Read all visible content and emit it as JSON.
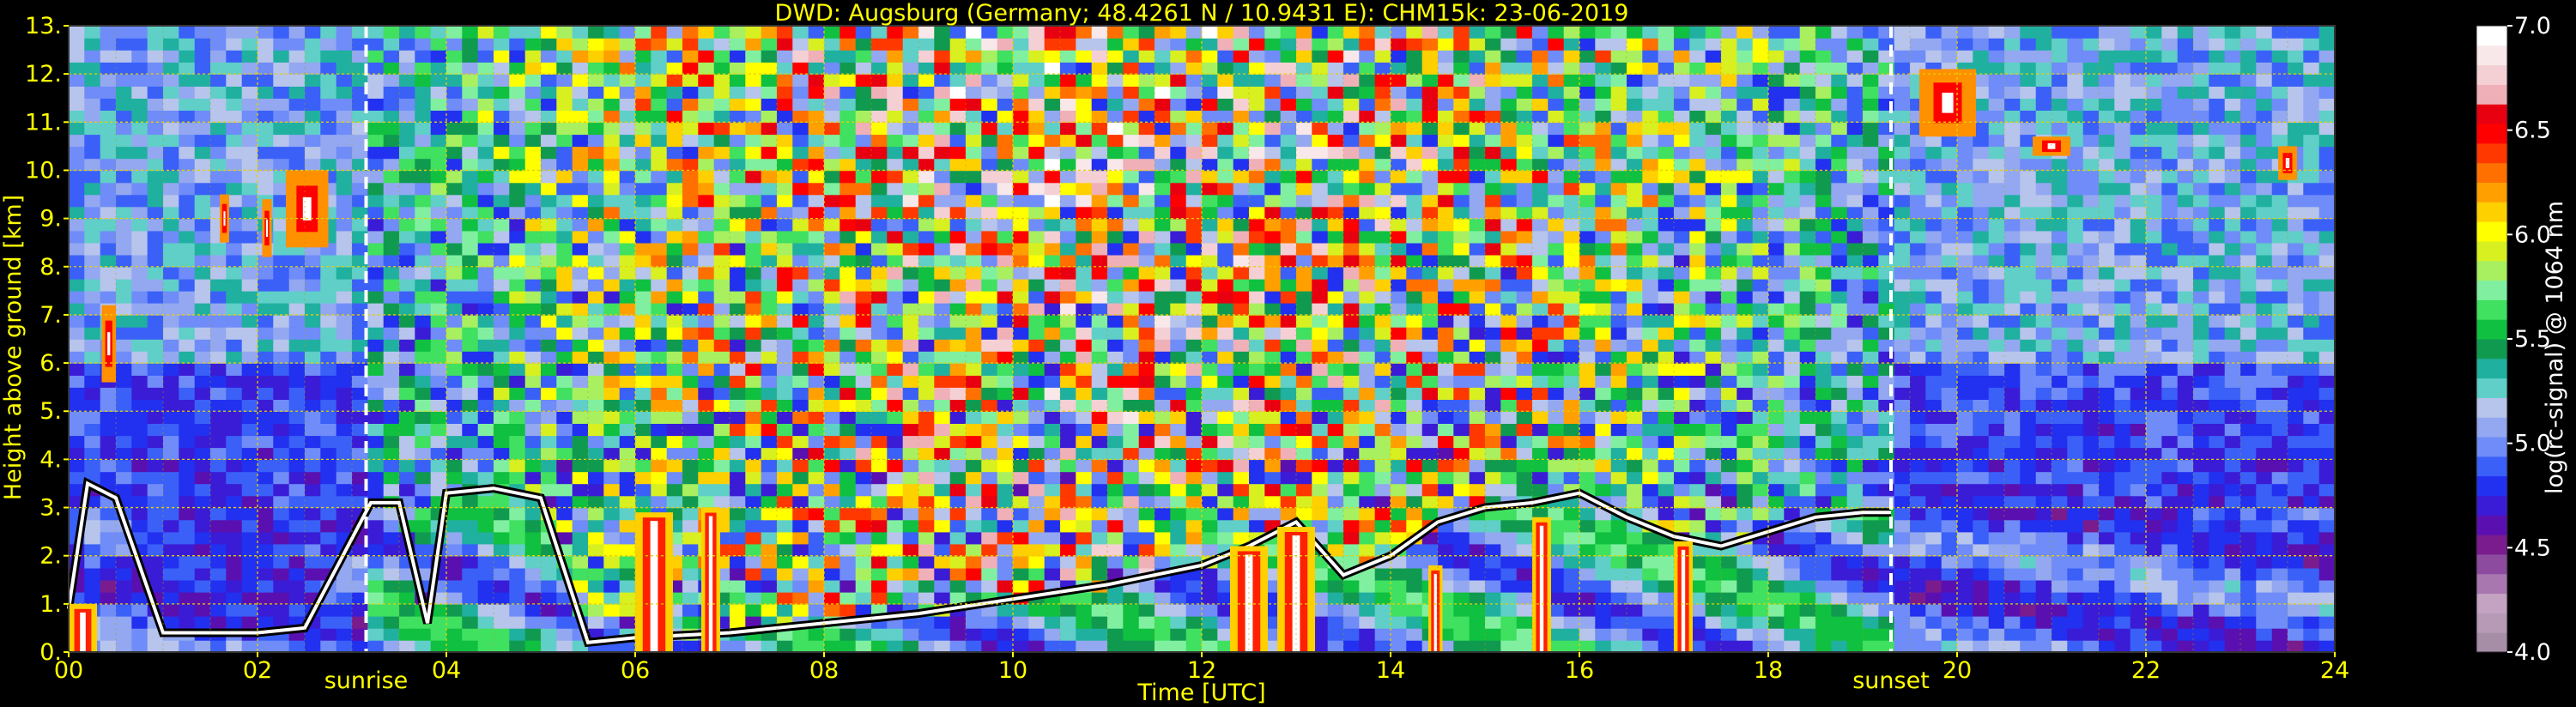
{
  "chart_data": {
    "type": "heatmap",
    "title": "DWD: Augsburg (Germany; 48.4261 N / 10.9431 E):    CHM15k: 23-06-2019",
    "xlabel": "Time [UTC]",
    "ylabel": "Height above ground [km]",
    "x_ticks": [
      "00",
      "02",
      "04",
      "06",
      "08",
      "10",
      "12",
      "14",
      "16",
      "18",
      "20",
      "22",
      "24"
    ],
    "xlim": [
      0,
      24
    ],
    "y_ticks": [
      "0.",
      "1.",
      "2.",
      "3.",
      "4.",
      "5.",
      "6.",
      "7.",
      "8.",
      "9.",
      "10.",
      "11.",
      "12.",
      "13."
    ],
    "ylim": [
      0,
      13
    ],
    "grid": true,
    "colorbar": {
      "label": "log(rc-signal) @ 1064 nm",
      "range": [
        4.0,
        7.0
      ],
      "ticks": [
        "4.0",
        "4.5",
        "5.0",
        "5.5",
        "6.0",
        "6.5",
        "7.0"
      ],
      "colors": [
        "#a58ea6",
        "#b79bb6",
        "#c4a3c2",
        "#a877b0",
        "#8d4ba0",
        "#7a1c8e",
        "#5a10b0",
        "#3a1cd6",
        "#2230f0",
        "#3a60f8",
        "#6f8cf8",
        "#93a8f0",
        "#b7c4ec",
        "#5fcfc8",
        "#20b0a0",
        "#109a50",
        "#10c040",
        "#40e060",
        "#80f0a0",
        "#a8f060",
        "#d8f020",
        "#ffff00",
        "#ffd000",
        "#ffa000",
        "#ff7000",
        "#ff3800",
        "#ff0000",
        "#e80010",
        "#f0b0b8",
        "#f4d0d4",
        "#f8e8ea",
        "#ffffff"
      ]
    },
    "markers": [
      {
        "label": "sunrise",
        "time": 3.15
      },
      {
        "label": "sunset",
        "time": 19.3
      }
    ],
    "boundary_layer_top": [
      [
        0.0,
        0.9
      ],
      [
        0.2,
        3.5
      ],
      [
        0.5,
        3.2
      ],
      [
        1.0,
        0.4
      ],
      [
        2.0,
        0.4
      ],
      [
        2.5,
        0.5
      ],
      [
        3.2,
        3.1
      ],
      [
        3.5,
        3.1
      ],
      [
        3.8,
        0.6
      ],
      [
        4.0,
        3.3
      ],
      [
        4.5,
        3.4
      ],
      [
        5.0,
        3.2
      ],
      [
        5.5,
        0.2
      ],
      [
        6.0,
        0.3
      ],
      [
        7.0,
        0.4
      ],
      [
        8.0,
        0.6
      ],
      [
        9.0,
        0.8
      ],
      [
        10.0,
        1.1
      ],
      [
        11.0,
        1.4
      ],
      [
        12.0,
        1.8
      ],
      [
        12.5,
        2.2
      ],
      [
        13.0,
        2.7
      ],
      [
        13.5,
        1.6
      ],
      [
        14.0,
        2.0
      ],
      [
        14.5,
        2.7
      ],
      [
        15.0,
        3.0
      ],
      [
        15.5,
        3.1
      ],
      [
        16.0,
        3.3
      ],
      [
        16.5,
        2.8
      ],
      [
        17.0,
        2.4
      ],
      [
        17.5,
        2.2
      ],
      [
        18.0,
        2.5
      ],
      [
        18.5,
        2.8
      ],
      [
        19.0,
        2.9
      ],
      [
        19.3,
        2.9
      ]
    ],
    "cloud_layers": [
      {
        "t0": 0.35,
        "t1": 0.5,
        "h0": 5.6,
        "h1": 7.2
      },
      {
        "t0": 2.05,
        "t1": 2.15,
        "h0": 8.2,
        "h1": 9.4
      },
      {
        "t0": 2.3,
        "t1": 2.75,
        "h0": 8.4,
        "h1": 10.0
      },
      {
        "t0": 1.6,
        "t1": 1.7,
        "h0": 8.5,
        "h1": 9.5
      },
      {
        "t0": 19.6,
        "t1": 20.2,
        "h0": 10.7,
        "h1": 12.1
      },
      {
        "t0": 20.8,
        "t1": 21.2,
        "h0": 10.3,
        "h1": 10.7
      },
      {
        "t0": 23.4,
        "t1": 23.6,
        "h0": 9.8,
        "h1": 10.5
      }
    ],
    "precipitation": [
      {
        "t0": 0.0,
        "t1": 0.3,
        "h1": 1.0
      },
      {
        "t0": 6.0,
        "t1": 6.4,
        "h1": 2.9
      },
      {
        "t0": 6.7,
        "t1": 6.9,
        "h1": 3.0
      },
      {
        "t0": 12.3,
        "t1": 12.7,
        "h1": 2.2
      },
      {
        "t0": 12.8,
        "t1": 13.2,
        "h1": 2.6
      },
      {
        "t0": 14.4,
        "t1": 14.55,
        "h1": 1.8
      },
      {
        "t0": 15.5,
        "t1": 15.7,
        "h1": 2.8
      },
      {
        "t0": 17.0,
        "t1": 17.2,
        "h1": 2.3
      }
    ]
  }
}
